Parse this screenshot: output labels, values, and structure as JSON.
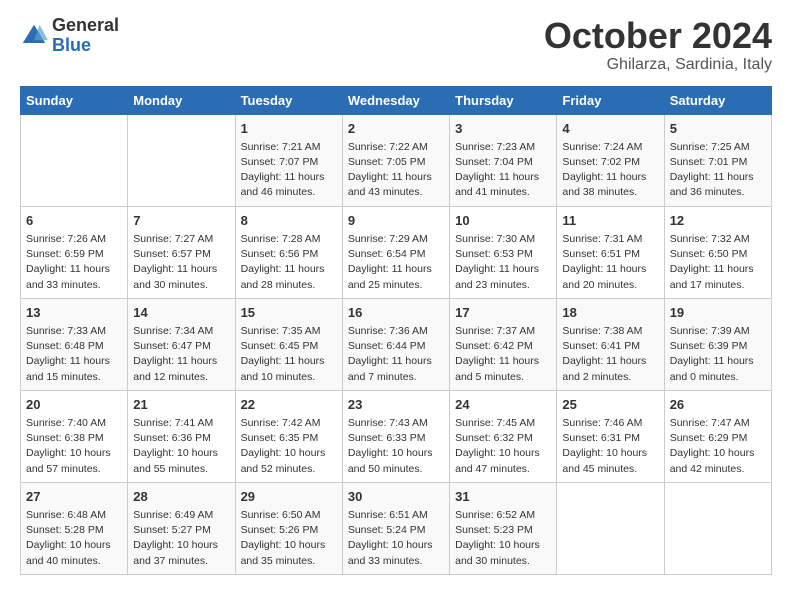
{
  "logo": {
    "general": "General",
    "blue": "Blue"
  },
  "title": {
    "month": "October 2024",
    "location": "Ghilarza, Sardinia, Italy"
  },
  "headers": [
    "Sunday",
    "Monday",
    "Tuesday",
    "Wednesday",
    "Thursday",
    "Friday",
    "Saturday"
  ],
  "weeks": [
    [
      {
        "day": "",
        "sunrise": "",
        "sunset": "",
        "daylight": ""
      },
      {
        "day": "",
        "sunrise": "",
        "sunset": "",
        "daylight": ""
      },
      {
        "day": "1",
        "sunrise": "Sunrise: 7:21 AM",
        "sunset": "Sunset: 7:07 PM",
        "daylight": "Daylight: 11 hours and 46 minutes."
      },
      {
        "day": "2",
        "sunrise": "Sunrise: 7:22 AM",
        "sunset": "Sunset: 7:05 PM",
        "daylight": "Daylight: 11 hours and 43 minutes."
      },
      {
        "day": "3",
        "sunrise": "Sunrise: 7:23 AM",
        "sunset": "Sunset: 7:04 PM",
        "daylight": "Daylight: 11 hours and 41 minutes."
      },
      {
        "day": "4",
        "sunrise": "Sunrise: 7:24 AM",
        "sunset": "Sunset: 7:02 PM",
        "daylight": "Daylight: 11 hours and 38 minutes."
      },
      {
        "day": "5",
        "sunrise": "Sunrise: 7:25 AM",
        "sunset": "Sunset: 7:01 PM",
        "daylight": "Daylight: 11 hours and 36 minutes."
      }
    ],
    [
      {
        "day": "6",
        "sunrise": "Sunrise: 7:26 AM",
        "sunset": "Sunset: 6:59 PM",
        "daylight": "Daylight: 11 hours and 33 minutes."
      },
      {
        "day": "7",
        "sunrise": "Sunrise: 7:27 AM",
        "sunset": "Sunset: 6:57 PM",
        "daylight": "Daylight: 11 hours and 30 minutes."
      },
      {
        "day": "8",
        "sunrise": "Sunrise: 7:28 AM",
        "sunset": "Sunset: 6:56 PM",
        "daylight": "Daylight: 11 hours and 28 minutes."
      },
      {
        "day": "9",
        "sunrise": "Sunrise: 7:29 AM",
        "sunset": "Sunset: 6:54 PM",
        "daylight": "Daylight: 11 hours and 25 minutes."
      },
      {
        "day": "10",
        "sunrise": "Sunrise: 7:30 AM",
        "sunset": "Sunset: 6:53 PM",
        "daylight": "Daylight: 11 hours and 23 minutes."
      },
      {
        "day": "11",
        "sunrise": "Sunrise: 7:31 AM",
        "sunset": "Sunset: 6:51 PM",
        "daylight": "Daylight: 11 hours and 20 minutes."
      },
      {
        "day": "12",
        "sunrise": "Sunrise: 7:32 AM",
        "sunset": "Sunset: 6:50 PM",
        "daylight": "Daylight: 11 hours and 17 minutes."
      }
    ],
    [
      {
        "day": "13",
        "sunrise": "Sunrise: 7:33 AM",
        "sunset": "Sunset: 6:48 PM",
        "daylight": "Daylight: 11 hours and 15 minutes."
      },
      {
        "day": "14",
        "sunrise": "Sunrise: 7:34 AM",
        "sunset": "Sunset: 6:47 PM",
        "daylight": "Daylight: 11 hours and 12 minutes."
      },
      {
        "day": "15",
        "sunrise": "Sunrise: 7:35 AM",
        "sunset": "Sunset: 6:45 PM",
        "daylight": "Daylight: 11 hours and 10 minutes."
      },
      {
        "day": "16",
        "sunrise": "Sunrise: 7:36 AM",
        "sunset": "Sunset: 6:44 PM",
        "daylight": "Daylight: 11 hours and 7 minutes."
      },
      {
        "day": "17",
        "sunrise": "Sunrise: 7:37 AM",
        "sunset": "Sunset: 6:42 PM",
        "daylight": "Daylight: 11 hours and 5 minutes."
      },
      {
        "day": "18",
        "sunrise": "Sunrise: 7:38 AM",
        "sunset": "Sunset: 6:41 PM",
        "daylight": "Daylight: 11 hours and 2 minutes."
      },
      {
        "day": "19",
        "sunrise": "Sunrise: 7:39 AM",
        "sunset": "Sunset: 6:39 PM",
        "daylight": "Daylight: 11 hours and 0 minutes."
      }
    ],
    [
      {
        "day": "20",
        "sunrise": "Sunrise: 7:40 AM",
        "sunset": "Sunset: 6:38 PM",
        "daylight": "Daylight: 10 hours and 57 minutes."
      },
      {
        "day": "21",
        "sunrise": "Sunrise: 7:41 AM",
        "sunset": "Sunset: 6:36 PM",
        "daylight": "Daylight: 10 hours and 55 minutes."
      },
      {
        "day": "22",
        "sunrise": "Sunrise: 7:42 AM",
        "sunset": "Sunset: 6:35 PM",
        "daylight": "Daylight: 10 hours and 52 minutes."
      },
      {
        "day": "23",
        "sunrise": "Sunrise: 7:43 AM",
        "sunset": "Sunset: 6:33 PM",
        "daylight": "Daylight: 10 hours and 50 minutes."
      },
      {
        "day": "24",
        "sunrise": "Sunrise: 7:45 AM",
        "sunset": "Sunset: 6:32 PM",
        "daylight": "Daylight: 10 hours and 47 minutes."
      },
      {
        "day": "25",
        "sunrise": "Sunrise: 7:46 AM",
        "sunset": "Sunset: 6:31 PM",
        "daylight": "Daylight: 10 hours and 45 minutes."
      },
      {
        "day": "26",
        "sunrise": "Sunrise: 7:47 AM",
        "sunset": "Sunset: 6:29 PM",
        "daylight": "Daylight: 10 hours and 42 minutes."
      }
    ],
    [
      {
        "day": "27",
        "sunrise": "Sunrise: 6:48 AM",
        "sunset": "Sunset: 5:28 PM",
        "daylight": "Daylight: 10 hours and 40 minutes."
      },
      {
        "day": "28",
        "sunrise": "Sunrise: 6:49 AM",
        "sunset": "Sunset: 5:27 PM",
        "daylight": "Daylight: 10 hours and 37 minutes."
      },
      {
        "day": "29",
        "sunrise": "Sunrise: 6:50 AM",
        "sunset": "Sunset: 5:26 PM",
        "daylight": "Daylight: 10 hours and 35 minutes."
      },
      {
        "day": "30",
        "sunrise": "Sunrise: 6:51 AM",
        "sunset": "Sunset: 5:24 PM",
        "daylight": "Daylight: 10 hours and 33 minutes."
      },
      {
        "day": "31",
        "sunrise": "Sunrise: 6:52 AM",
        "sunset": "Sunset: 5:23 PM",
        "daylight": "Daylight: 10 hours and 30 minutes."
      },
      {
        "day": "",
        "sunrise": "",
        "sunset": "",
        "daylight": ""
      },
      {
        "day": "",
        "sunrise": "",
        "sunset": "",
        "daylight": ""
      }
    ]
  ]
}
